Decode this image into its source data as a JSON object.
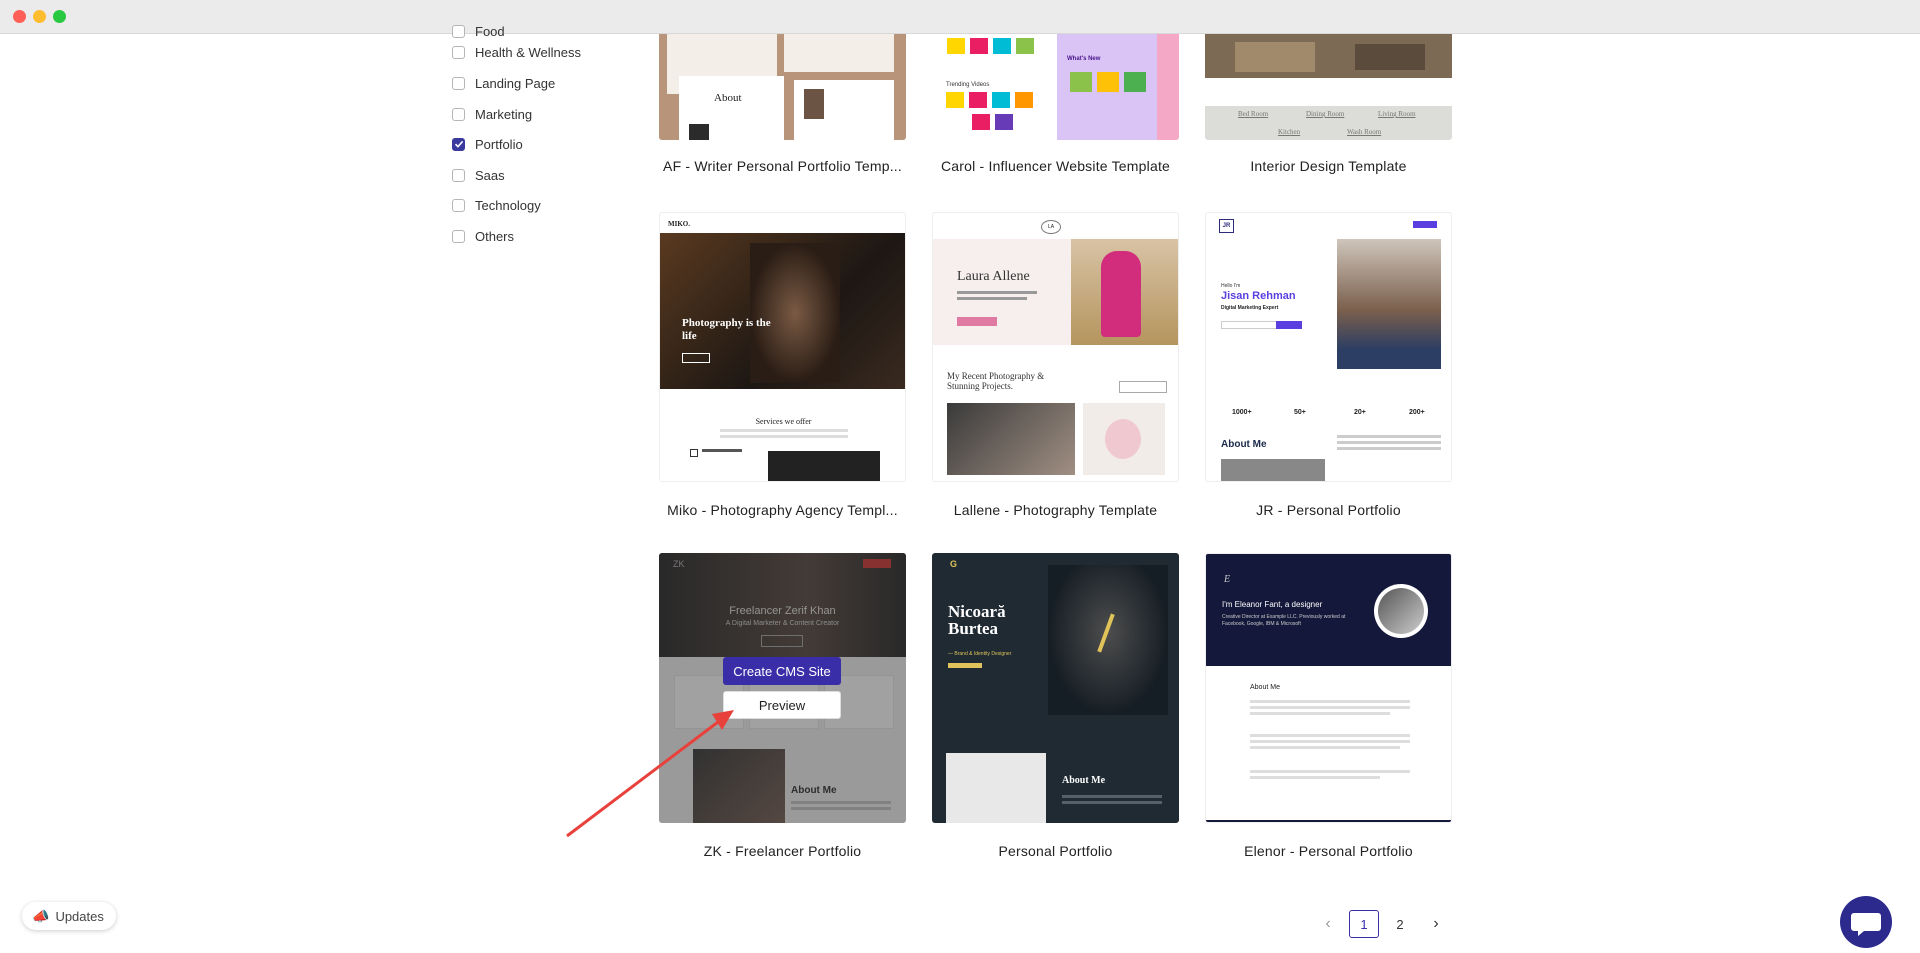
{
  "filters": [
    {
      "label": "Food",
      "checked": false
    },
    {
      "label": "Health & Wellness",
      "checked": false
    },
    {
      "label": "Landing Page",
      "checked": false
    },
    {
      "label": "Marketing",
      "checked": false
    },
    {
      "label": "Portfolio",
      "checked": true
    },
    {
      "label": "Saas",
      "checked": false
    },
    {
      "label": "Technology",
      "checked": false
    },
    {
      "label": "Others",
      "checked": false
    }
  ],
  "cards": [
    {
      "title": "AF - Writer Personal Portfolio Temp...",
      "thumb": {
        "heading": "About"
      }
    },
    {
      "title": "Carol - Influencer Website Template",
      "thumb": {
        "heading": "What's New",
        "sub": "Trending Videos"
      }
    },
    {
      "title": "Interior Design Template",
      "thumb": {
        "links": [
          "Bed Room",
          "Dining Room",
          "Living Room",
          "Kitchen",
          "Wash Room"
        ]
      }
    },
    {
      "title": "Miko - Photography Agency Templ...",
      "thumb": {
        "logo": "MIKO.",
        "heading": "Photography is the life",
        "section": "Services we offer"
      }
    },
    {
      "title": "Lallene - Photography Template",
      "thumb": {
        "logo": "LA",
        "heading": "Laura Allene",
        "section": "My Recent Photography & Stunning Projects."
      }
    },
    {
      "title": "JR - Personal Portfolio",
      "thumb": {
        "logo": "JR",
        "greeting": "Hello I'm",
        "heading": "Jisan Rehman",
        "sub": "Digital Marketing Expert",
        "stats": [
          "1000+",
          "50+",
          "20+",
          "200+"
        ],
        "section": "About Me"
      }
    },
    {
      "title": "ZK - Freelancer Portfolio",
      "thumb": {
        "logo": "ZK",
        "heading": "Freelancer Zerif Khan",
        "sub": "A Digital Marketer & Content Creator",
        "section": "About Me"
      }
    },
    {
      "title": "Personal Portfolio",
      "thumb": {
        "logo": "G",
        "heading": "Nicoară Burtea",
        "sub": "— Brand & Identity Designer",
        "section": "About Me"
      }
    },
    {
      "title": "Elenor - Personal Portfolio",
      "thumb": {
        "logo": "E",
        "heading": "I'm Eleanor Fant, a designer",
        "sub": "Creative Director at Example LLC. Previously worked at Facebook, Google, IBM & Microsoft",
        "section": "About Me"
      }
    }
  ],
  "overlay": {
    "create_label": "Create CMS Site",
    "preview_label": "Preview"
  },
  "pagination": {
    "pages": [
      "1",
      "2"
    ],
    "current": "1"
  },
  "updates_label": "Updates",
  "colors": {
    "accent": "#3a2ea8",
    "annotation_arrow": "#e8413c"
  }
}
